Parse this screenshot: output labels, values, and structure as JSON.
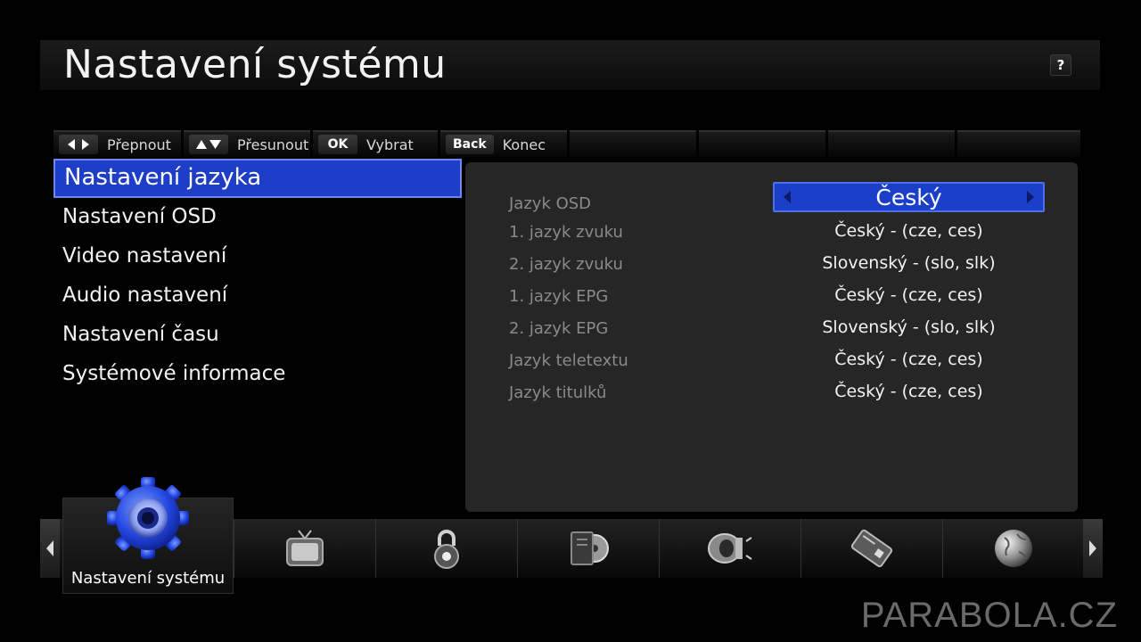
{
  "header": {
    "title": "Nastavení systému",
    "help_label": "?"
  },
  "hints": [
    {
      "key_icon": "left-right-arrows-icon",
      "label": "Přepnout"
    },
    {
      "key_icon": "up-down-arrows-icon",
      "label": "Přesunout"
    },
    {
      "key": "OK",
      "label": "Vybrat"
    },
    {
      "key": "Back",
      "label": "Konec"
    }
  ],
  "menu": {
    "items": [
      {
        "label": "Nastavení jazyka",
        "active": true
      },
      {
        "label": "Nastavení OSD"
      },
      {
        "label": "Video nastavení"
      },
      {
        "label": "Audio nastavení"
      },
      {
        "label": "Nastavení času"
      },
      {
        "label": "Systémové informace"
      }
    ]
  },
  "settings": [
    {
      "label": "Jazyk OSD",
      "value": "Český",
      "selected": true
    },
    {
      "label": "1. jazyk zvuku",
      "value": "Český - (cze, ces)"
    },
    {
      "label": "2. jazyk zvuku",
      "value": "Slovenský - (slo, slk)"
    },
    {
      "label": "1. jazyk EPG",
      "value": "Český - (cze, ces)"
    },
    {
      "label": "2. jazyk EPG",
      "value": "Slovenský - (slo, slk)"
    },
    {
      "label": "Jazyk teletextu",
      "value": "Český - (cze, ces)"
    },
    {
      "label": "Jazyk titulků",
      "value": "Český - (cze, ces)"
    }
  ],
  "dock": {
    "active_label": "Nastavení systému",
    "active_icon": "gear-icon",
    "icons": [
      "tv-icon",
      "padlock-icon",
      "media-icon",
      "speaker-icon",
      "smartcard-icon",
      "globe-icon"
    ]
  },
  "watermark": "PARABOLA.CZ",
  "colors": {
    "selection": "#1e3ec8",
    "panel": "#262626",
    "label_text": "#8a8a8a"
  }
}
